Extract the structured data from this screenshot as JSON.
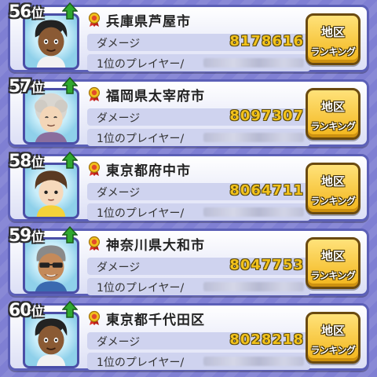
{
  "rows": [
    {
      "rank_num": "56",
      "rank_suffix": "位",
      "city": "兵庫県芦屋市",
      "damage_label": "ダメージ",
      "damage_value": "8178616",
      "player_label": "1位のプレイヤー/",
      "button_l1": "地区",
      "button_l2": "ランキング",
      "avatar": "dark-skinned-boy"
    },
    {
      "rank_num": "57",
      "rank_suffix": "位",
      "city": "福岡県太宰府市",
      "damage_label": "ダメージ",
      "damage_value": "8097307",
      "player_label": "1位のプレイヤー/",
      "button_l1": "地区",
      "button_l2": "ランキング",
      "avatar": "elderly-woman"
    },
    {
      "rank_num": "58",
      "rank_suffix": "位",
      "city": "東京都府中市",
      "damage_label": "ダメージ",
      "damage_value": "8064711",
      "player_label": "1位のプレイヤー/",
      "button_l1": "地区",
      "button_l2": "ランキング",
      "avatar": "boy-brown-hair"
    },
    {
      "rank_num": "59",
      "rank_suffix": "位",
      "city": "神奈川県大和市",
      "damage_label": "ダメージ",
      "damage_value": "8047753",
      "player_label": "1位のプレイヤー/",
      "button_l1": "地区",
      "button_l2": "ランキング",
      "avatar": "man-sunglasses"
    },
    {
      "rank_num": "60",
      "rank_suffix": "位",
      "city": "東京都千代田区",
      "damage_label": "ダメージ",
      "damage_value": "8028218",
      "player_label": "1位のプレイヤー/",
      "button_l1": "地区",
      "button_l2": "ランキング",
      "avatar": "dark-skinned-boy"
    }
  ],
  "colors": {
    "background": "#7f7fd3",
    "card_border": "#5b5fb7",
    "damage_gold": "#f2c21c",
    "button_gold": "#f2b51a",
    "up_arrow": "#2fa82f"
  },
  "icons": {
    "rank_trend": "up-arrow-icon",
    "medal": "medal-icon"
  }
}
